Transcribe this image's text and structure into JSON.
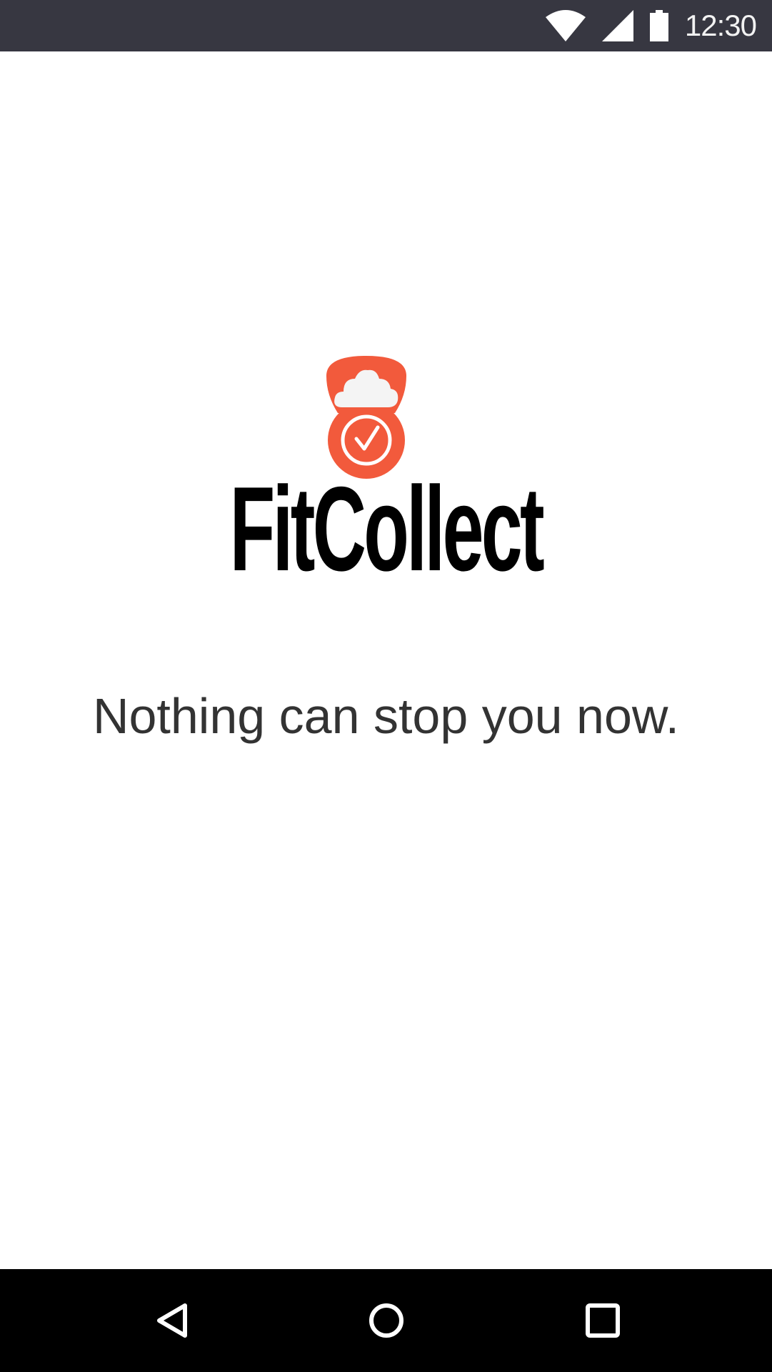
{
  "status_bar": {
    "time": "12:30",
    "icons": [
      "wifi-icon",
      "cell-signal-icon",
      "battery-icon"
    ],
    "background": "#373741"
  },
  "splash": {
    "app_name": "FitCollect",
    "tagline": "Nothing can stop you now.",
    "logo_icon": "kettlebell-cloud-check-icon",
    "accent_color": "#F25A3C"
  },
  "nav_bar": {
    "buttons": [
      "back-icon",
      "home-icon",
      "recents-icon"
    ],
    "background": "#000000"
  }
}
